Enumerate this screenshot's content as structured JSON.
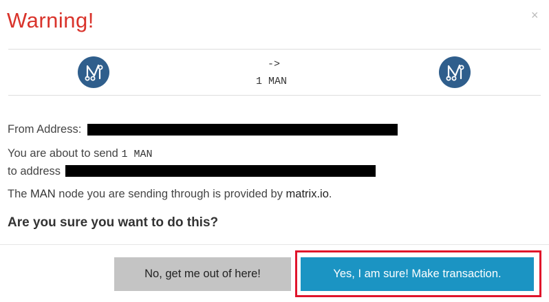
{
  "modal": {
    "title": "Warning!",
    "close_icon": "×"
  },
  "summary": {
    "arrow": "->",
    "amount": "1 MAN",
    "from_logo_icon": "matrix-logo-icon",
    "to_logo_icon": "matrix-logo-icon"
  },
  "details": {
    "from_label": "From Address:",
    "send_prefix": "You are about to send",
    "send_amount": "1 MAN",
    "to_label": "to address",
    "node_prefix": "The",
    "node_coin": "MAN",
    "node_middle": "node you are sending through is provided by",
    "node_provider": "matrix.io",
    "node_suffix": ".",
    "question": "Are you sure you want to do this?"
  },
  "actions": {
    "cancel_label": "No, get me out of here!",
    "confirm_label": "Yes, I am sure! Make transaction."
  },
  "colors": {
    "title": "#d9332b",
    "logo_bg": "#2f5e8c",
    "confirm_bg": "#1b94c3",
    "cancel_bg": "#c4c4c4",
    "highlight": "#e0142b"
  }
}
